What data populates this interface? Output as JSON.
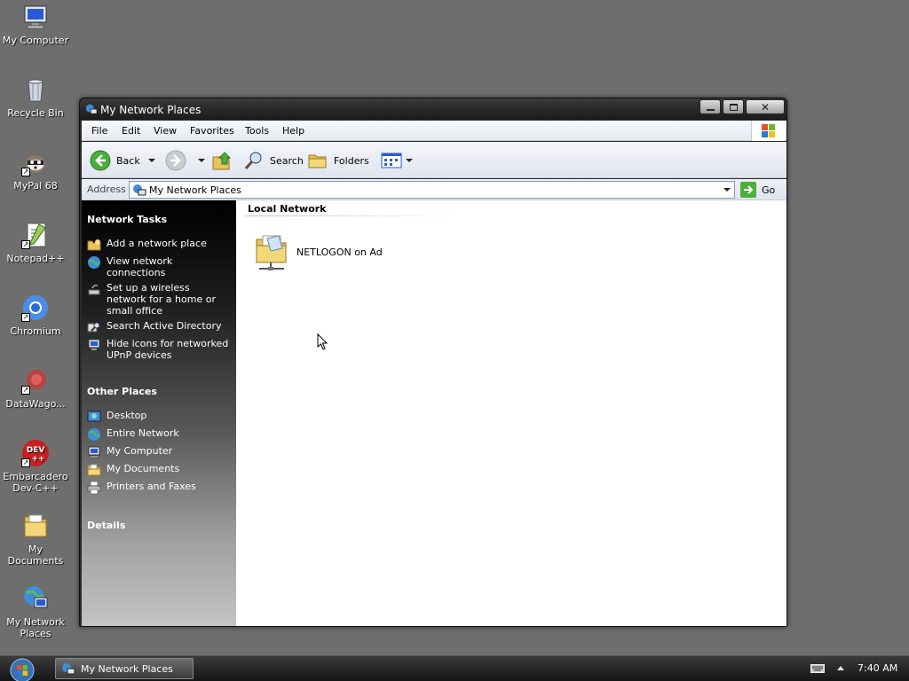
{
  "desktop": {
    "icons": [
      {
        "label": "My Computer"
      },
      {
        "label": "Recycle Bin"
      },
      {
        "label": "MyPal 68"
      },
      {
        "label": "Notepad++"
      },
      {
        "label": "Chromium"
      },
      {
        "label": "DataWago..."
      },
      {
        "label": "Embarcadero Dev-C++"
      },
      {
        "label": "My Documents"
      },
      {
        "label": "My Network Places"
      }
    ]
  },
  "window": {
    "title": "My Network Places",
    "menu": [
      "File",
      "Edit",
      "View",
      "Favorites",
      "Tools",
      "Help"
    ],
    "toolbar": {
      "back": "Back",
      "search": "Search",
      "folders": "Folders"
    },
    "address": {
      "label": "Address",
      "value": "My Network Places",
      "go": "Go"
    },
    "left_pane": {
      "network_tasks": {
        "title": "Network Tasks",
        "items": [
          {
            "label": "Add a network place",
            "icon": "add-network-place-icon"
          },
          {
            "label": "View network connections",
            "icon": "network-connections-icon"
          },
          {
            "label": "Set up a wireless network for a home or small office",
            "icon": "wireless-icon"
          },
          {
            "label": "Search Active Directory",
            "icon": "active-directory-icon"
          },
          {
            "label": "Hide icons for networked UPnP devices",
            "icon": "upnp-icon"
          }
        ]
      },
      "other_places": {
        "title": "Other Places",
        "items": [
          {
            "label": "Desktop",
            "icon": "desktop-icon"
          },
          {
            "label": "Entire Network",
            "icon": "globe-icon"
          },
          {
            "label": "My Computer",
            "icon": "computer-icon"
          },
          {
            "label": "My Documents",
            "icon": "folder-icon"
          },
          {
            "label": "Printers and Faxes",
            "icon": "printer-icon"
          }
        ]
      },
      "details": {
        "title": "Details"
      }
    },
    "content": {
      "group": "Local Network",
      "items": [
        {
          "label": "NETLOGON on Ad",
          "icon": "network-share-icon"
        }
      ]
    }
  },
  "taskbar": {
    "task": "My Network Places",
    "clock": "7:40 AM"
  }
}
